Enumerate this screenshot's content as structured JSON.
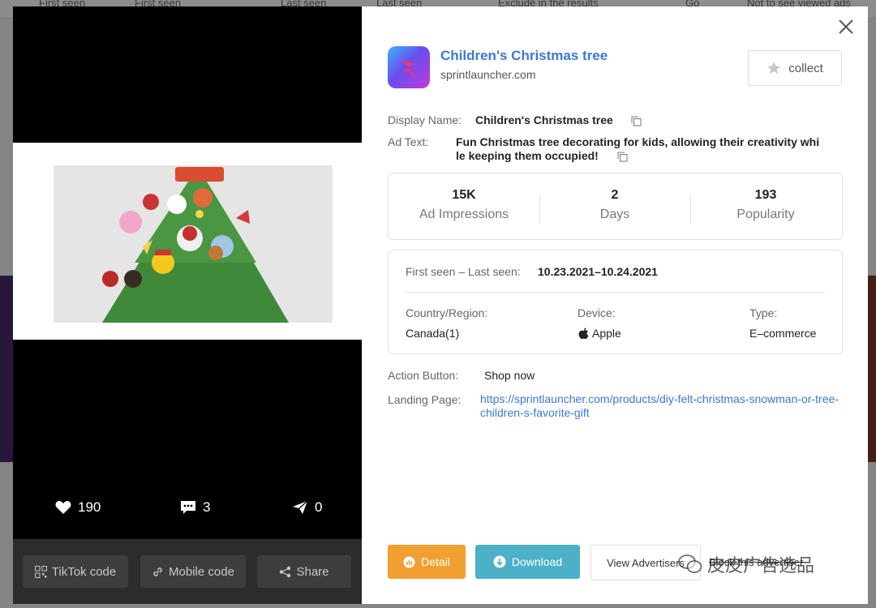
{
  "background": {
    "filters": [
      "First seen",
      "First seen",
      "Last seen",
      "Last seen",
      "Exclude in the results",
      "Go",
      "Not to see viewed ads"
    ]
  },
  "media": {
    "stats": {
      "likes": "190",
      "comments": "3",
      "shares": "0"
    },
    "buttons": {
      "tiktok_code": "TikTok code",
      "mobile_code": "Mobile code",
      "share": "Share"
    }
  },
  "app": {
    "name": "Children's Christmas tree",
    "domain": "sprintlauncher.com",
    "collect_label": "collect",
    "icon": "rocket-app-logo"
  },
  "details": {
    "display_name_label": "Display Name:",
    "display_name": "Children's Christmas tree",
    "ad_text_label": "Ad Text:",
    "ad_text_line1": "Fun Christmas tree decorating for kids, allowing their creativity whi",
    "ad_text_line2": "le keeping them occupied!"
  },
  "metrics": [
    {
      "value": "15K",
      "label": "Ad Impressions"
    },
    {
      "value": "2",
      "label": "Days"
    },
    {
      "value": "193",
      "label": "Popularity"
    }
  ],
  "info": {
    "seen_label": "First seen – Last seen:",
    "seen_value": "10.23.2021–10.24.2021",
    "country_label": "Country/Region:",
    "country_value": "Canada(1)",
    "device_label": "Device:",
    "device_value": "Apple",
    "type_label": "Type:",
    "type_value": "E–commerce"
  },
  "action": {
    "label": "Action Button:",
    "value": "Shop now"
  },
  "landing": {
    "label": "Landing Page:",
    "url": "https://sprintlauncher.com/products/diy-felt-christmas-snowman-or-tree-children-s-favorite-gift"
  },
  "footer": {
    "detail": "Detail",
    "download": "Download",
    "view_advertisers": "View Advertisers",
    "block": "Block this advertiser",
    "watermark": "皮皮广告选品"
  },
  "colors": {
    "link": "#3a78d4",
    "detail_btn": "#f0a030",
    "download_btn": "#4bb0c8"
  }
}
